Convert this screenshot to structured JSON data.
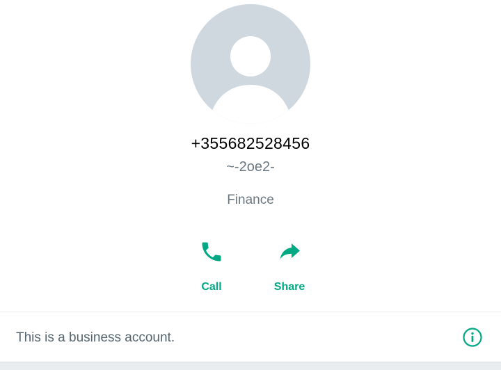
{
  "profile": {
    "avatar_icon": "default-person-avatar-icon",
    "phone_number": "+355682528456",
    "push_name": "~-2oe2-",
    "category": "Finance"
  },
  "actions": {
    "call": {
      "label": "Call",
      "icon": "phone-icon"
    },
    "share": {
      "label": "Share",
      "icon": "share-arrow-icon"
    }
  },
  "business_notice": {
    "text": "This is a business account.",
    "icon": "info-icon"
  },
  "colors": {
    "accent": "#00a884",
    "avatar_background": "#cfd8df",
    "secondary_text": "#6b7780"
  }
}
